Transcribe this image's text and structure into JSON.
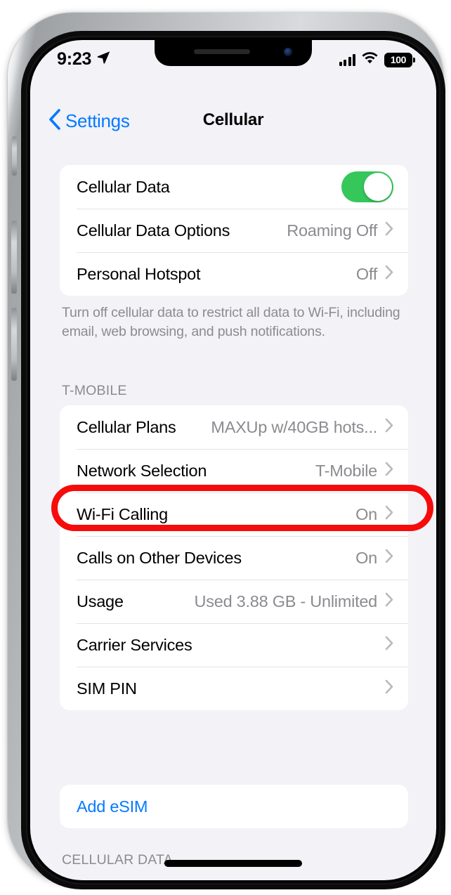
{
  "status_bar": {
    "time": "9:23",
    "location_icon": "location-arrow-icon",
    "signal_icon": "cellular-signal-icon",
    "wifi_icon": "wifi-icon",
    "battery_level": "100"
  },
  "nav": {
    "back_icon": "chevron-left-icon",
    "back_label": "Settings",
    "title": "Cellular"
  },
  "sections": [
    {
      "header": "",
      "rows": [
        {
          "label": "Cellular Data",
          "value": "",
          "control": "toggle",
          "toggle_on": true
        },
        {
          "label": "Cellular Data Options",
          "value": "Roaming Off",
          "control": "chevron"
        },
        {
          "label": "Personal Hotspot",
          "value": "Off",
          "control": "chevron"
        }
      ],
      "footer": "Turn off cellular data to restrict all data to Wi-Fi, including email, web browsing, and push notifications."
    },
    {
      "header": "T-MOBILE",
      "rows": [
        {
          "label": "Cellular Plans",
          "value": "MAXUp w/40GB hots...",
          "control": "chevron"
        },
        {
          "label": "Network Selection",
          "value": "T-Mobile",
          "control": "chevron",
          "highlighted": true
        },
        {
          "label": "Wi-Fi Calling",
          "value": "On",
          "control": "chevron"
        },
        {
          "label": "Calls on Other Devices",
          "value": "On",
          "control": "chevron"
        },
        {
          "label": "Usage",
          "value": "Used 3.88 GB - Unlimited",
          "control": "chevron"
        },
        {
          "label": "Carrier Services",
          "value": "",
          "control": "chevron"
        },
        {
          "label": "SIM PIN",
          "value": "",
          "control": "chevron"
        }
      ],
      "footer": ""
    },
    {
      "header": "",
      "rows": [
        {
          "label": "Add eSIM",
          "value": "",
          "control": "none",
          "link": true
        }
      ],
      "footer": ""
    }
  ],
  "bottom_header": "CELLULAR DATA",
  "annotation": {
    "type": "red-oval-highlight",
    "target": "Network Selection",
    "color": "#f60b0b"
  },
  "colors": {
    "accent_blue": "#057aff",
    "toggle_green": "#35c75a",
    "background": "#f2f2f7",
    "card": "#ffffff",
    "secondary_text": "#8b8b90",
    "highlight_red": "#f60b0b"
  }
}
